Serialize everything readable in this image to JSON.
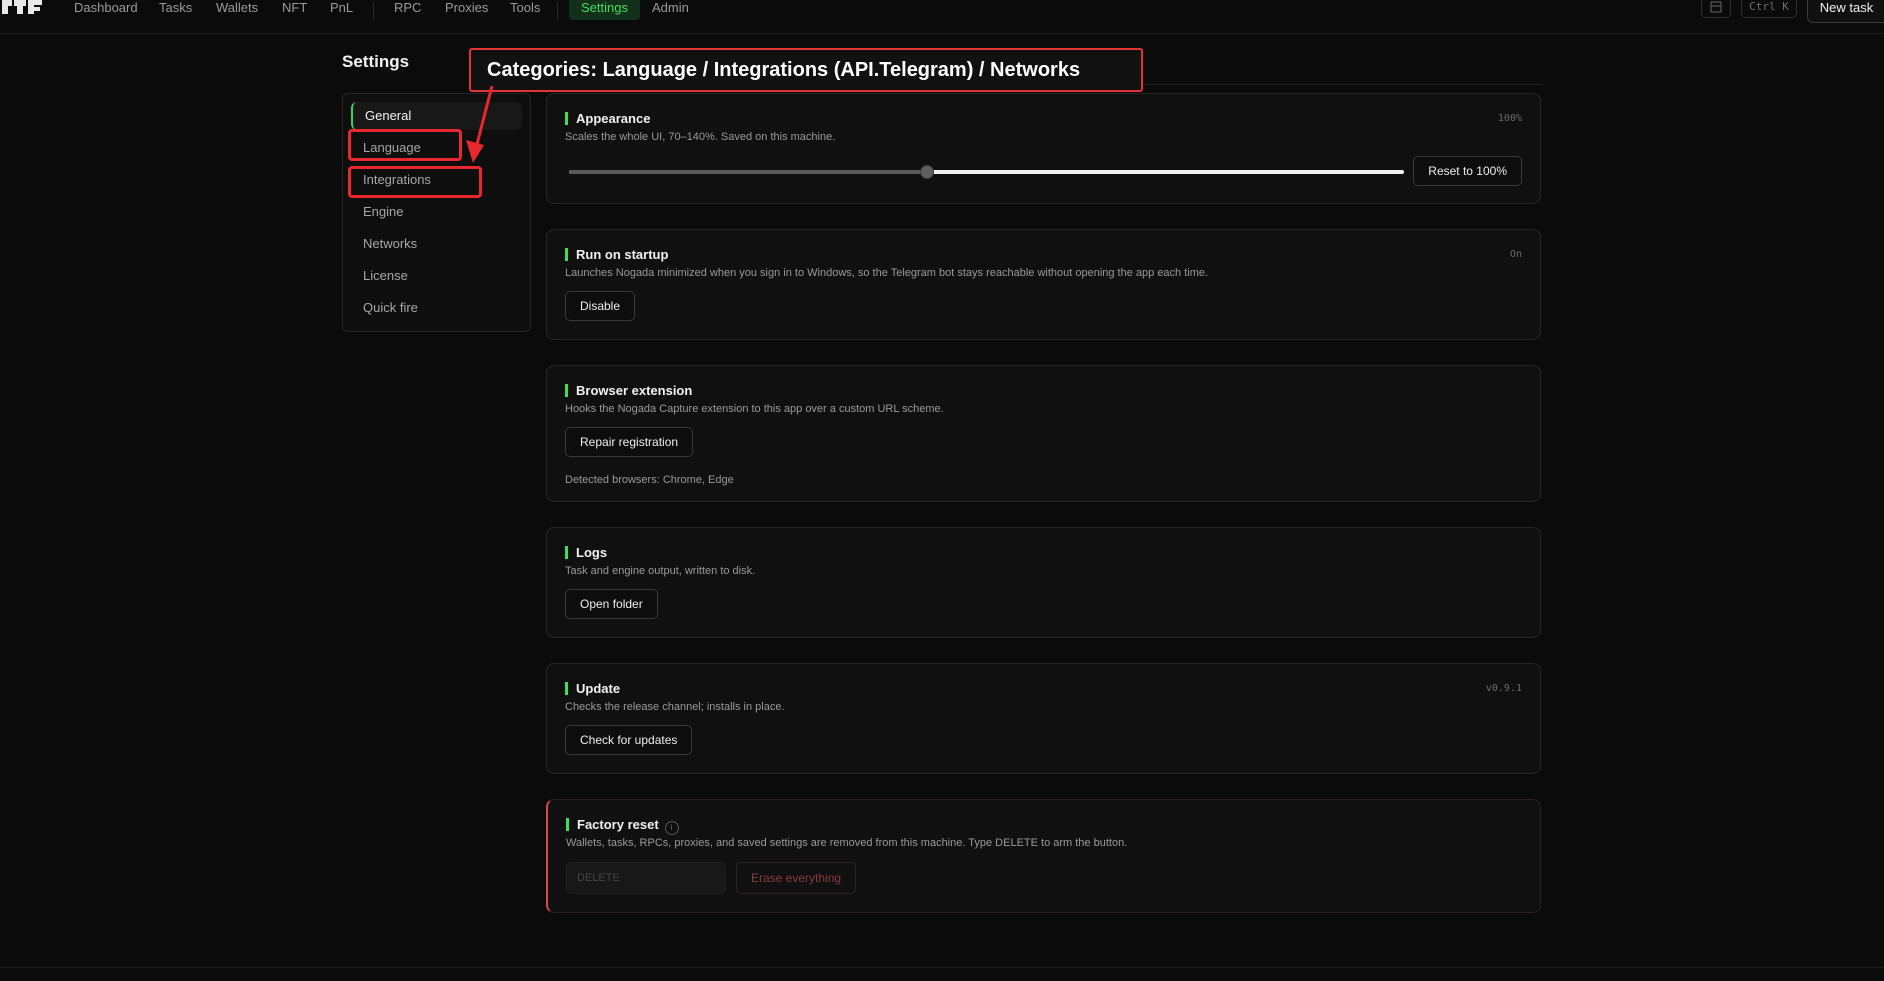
{
  "nav": {
    "items": [
      "Dashboard",
      "Tasks",
      "Wallets",
      "NFT",
      "PnL",
      "RPC",
      "Proxies",
      "Tools",
      "Settings",
      "Admin"
    ],
    "active": "Settings",
    "shortcut": "Ctrl K",
    "new_task": "New task"
  },
  "page": {
    "title": "Settings"
  },
  "sidebar": {
    "items": [
      "General",
      "Language",
      "Integrations",
      "Engine",
      "Networks",
      "License",
      "Quick fire"
    ],
    "active": "General"
  },
  "cards": {
    "appearance": {
      "title": "Appearance",
      "desc": "Scales the whole UI, 70–140%. Saved on this machine.",
      "meta": "100%",
      "slider": {
        "min": 70,
        "max": 140,
        "value": 100
      },
      "button": "Reset to 100%"
    },
    "startup": {
      "title": "Run on startup",
      "desc": "Launches Nogada minimized when you sign in to Windows, so the Telegram bot stays reachable without opening the app each time.",
      "meta": "On",
      "button": "Disable"
    },
    "extension": {
      "title": "Browser extension",
      "desc": "Hooks the Nogada Capture extension to this app over a custom URL scheme.",
      "button": "Repair registration",
      "detected": "Detected browsers: Chrome, Edge"
    },
    "logs": {
      "title": "Logs",
      "desc": "Task and engine output, written to disk.",
      "button": "Open folder"
    },
    "update": {
      "title": "Update",
      "desc": "Checks the release channel; installs in place.",
      "meta": "v0.9.1",
      "button": "Check for updates"
    },
    "reset": {
      "title": "Factory reset",
      "desc": "Wallets, tasks, RPCs, proxies, and saved settings are removed from this machine. Type DELETE to arm the button.",
      "placeholder": "DELETE",
      "button": "Erase everything"
    }
  },
  "annotation": {
    "text": "Categories: Language / Integrations (API.Telegram) / Networks",
    "color": "#e23434"
  },
  "colors": {
    "accent": "#3fdd5b",
    "danger": "#e04848",
    "background": "#0b0b0b"
  }
}
